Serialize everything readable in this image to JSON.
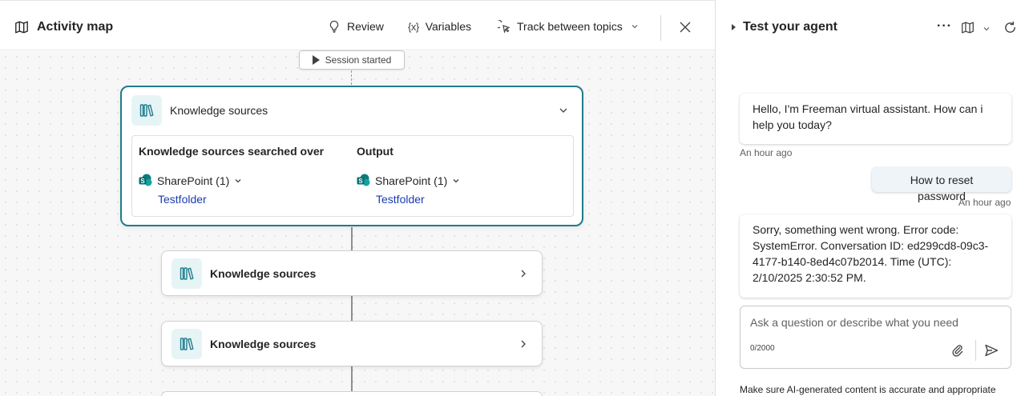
{
  "activity_map": {
    "title": "Activity map",
    "icon": "map-icon",
    "toolbar": {
      "review_label": "Review",
      "variables_label": "Variables",
      "variables_icon_glyph": "{x}",
      "track_label": "Track between topics"
    }
  },
  "flow": {
    "session_label": "Session started",
    "expanded_node": {
      "title": "Knowledge sources",
      "searched_header": "Knowledge sources searched over",
      "output_header": "Output",
      "searched_source": "SharePoint (1)",
      "searched_link": "Testfolder",
      "output_source": "SharePoint (1)",
      "output_link": "Testfolder"
    },
    "collapsed_nodes": [
      {
        "title": "Knowledge sources"
      },
      {
        "title": "Knowledge sources"
      },
      {
        "title": ""
      }
    ]
  },
  "test_panel": {
    "title": "Test your agent",
    "more_glyph": "···",
    "messages": [
      {
        "role": "bot",
        "text": "Hello, I'm Freeman virtual assistant. How can i help you today?",
        "time": "An hour ago"
      },
      {
        "role": "user",
        "text": "How to reset password",
        "time": "An hour ago"
      },
      {
        "role": "bot",
        "text": "Sorry, something went wrong. Error code: SystemError. Conversation ID: ed299cd8-09c3-4177-b140-8ed4c07b2014. Time (UTC): 2/10/2025 2:30:52 PM."
      }
    ],
    "input_placeholder": "Ask a question or describe what you need",
    "char_counter": "0/2000",
    "footnote": "Make sure AI-generated content is accurate and appropriate"
  },
  "colors": {
    "accent": "#1f7c8c",
    "link": "#1a3bb4",
    "sharepoint": "#0f7b7b"
  }
}
